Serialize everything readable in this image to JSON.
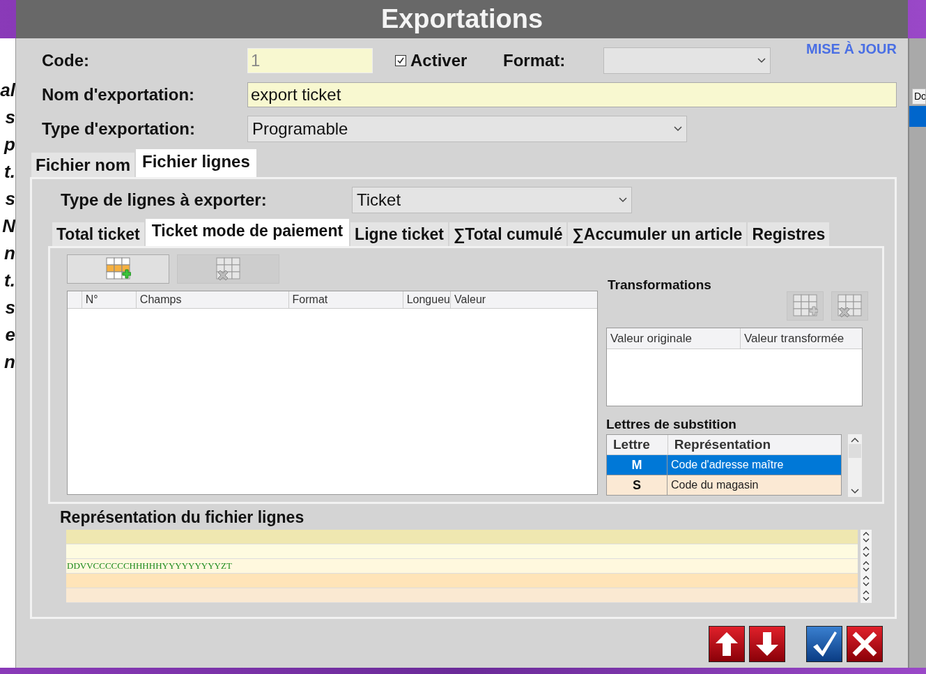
{
  "background_app": {
    "left_fragments": [
      "al",
      "s",
      "p",
      "t.",
      "s",
      "N",
      "n",
      "t.",
      "s",
      "e",
      "n"
    ],
    "right_tab": "Do"
  },
  "window": {
    "title": "Exportations"
  },
  "update_link": "MISE À JOUR",
  "form": {
    "code": {
      "label": "Code:",
      "value": "1",
      "disabled": true
    },
    "activer": {
      "label": "Activer",
      "checked": true
    },
    "format": {
      "label": "Format:"
    },
    "name": {
      "label": "Nom d'exportation:",
      "value": "export ticket"
    },
    "type": {
      "label": "Type d'exportation:",
      "value": "Programable"
    }
  },
  "tabs": [
    {
      "label": "Fichier nom",
      "selected": false
    },
    {
      "label": "Fichier lignes",
      "selected": true
    }
  ],
  "line_type": {
    "label": "Type de lignes à exporter:",
    "value": "Ticket"
  },
  "subtabs": [
    {
      "label": "Total ticket",
      "selected": false
    },
    {
      "label": "Ticket mode de paiement",
      "selected": true
    },
    {
      "label": "Ligne ticket",
      "selected": false
    },
    {
      "label": "∑Total cumulé",
      "selected": false
    },
    {
      "label": "∑Accumuler un article",
      "selected": false
    },
    {
      "label": "Registres",
      "selected": false
    }
  ],
  "fields_table": {
    "buttons": [
      {
        "kind": "add",
        "disabled": false
      },
      {
        "kind": "delete",
        "disabled": true
      }
    ],
    "columns": [
      "N°",
      "Champs",
      "Format",
      "Longueu",
      "Valeur"
    ]
  },
  "transformations": {
    "title": "Transformations",
    "buttons": [
      {
        "kind": "add",
        "disabled": true
      },
      {
        "kind": "delete",
        "disabled": true
      }
    ],
    "columns": [
      "Valeur originale",
      "Valeur transformée"
    ]
  },
  "substitution": {
    "title": "Lettres de substition",
    "columns": [
      "Lettre",
      "Représentation"
    ],
    "rows": [
      {
        "letter": "M",
        "representation": "Code d'adresse maître",
        "selected": true
      },
      {
        "letter": "S",
        "representation": "Code du magasin",
        "selected": false
      }
    ]
  },
  "representation": {
    "title": "Représentation du fichier lignes",
    "lines": [
      {
        "color": "#efe7b0"
      },
      {
        "color": "#fefbe0"
      },
      {
        "text": "DDVVCCCCCCHHHHHYYYYYYYYYZT",
        "color": "#fff8de"
      },
      {
        "color": "#ffe4b8"
      },
      {
        "color": "#fae9d2"
      }
    ]
  },
  "actions": [
    {
      "kind": "up"
    },
    {
      "kind": "down"
    },
    {
      "kind": "ok"
    },
    {
      "kind": "cancel"
    }
  ]
}
